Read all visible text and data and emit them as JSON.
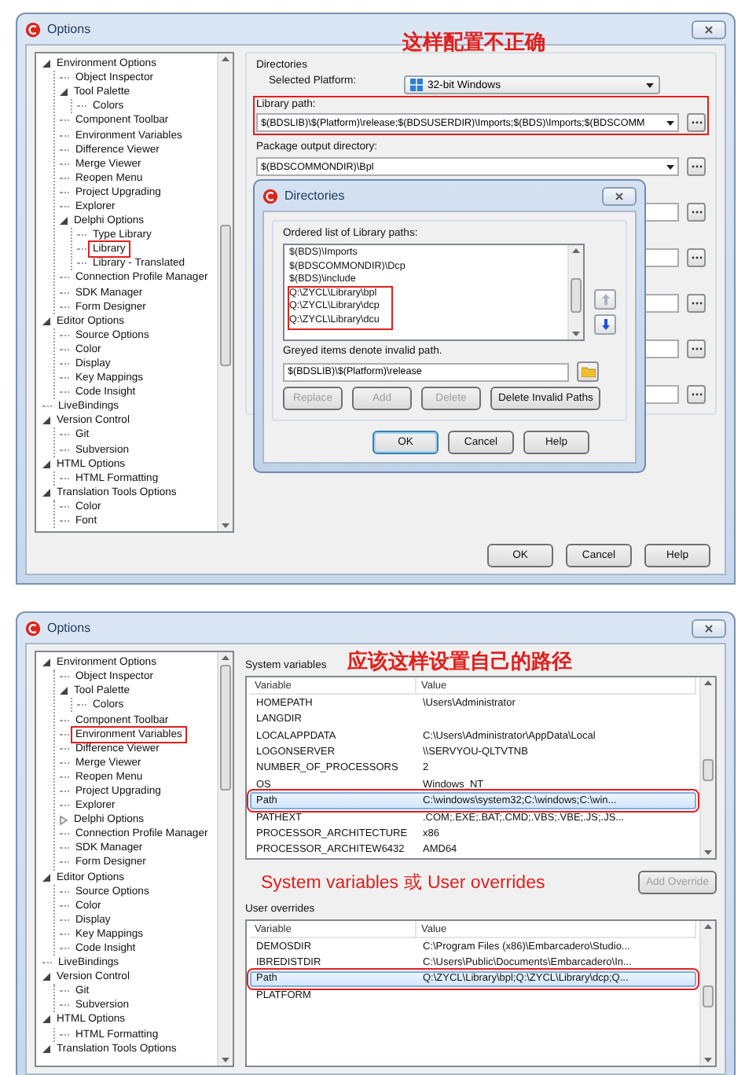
{
  "top_window": {
    "title": "Options",
    "annotation": "这样配置不正确",
    "tree": [
      {
        "label": "Environment Options",
        "highlighted": false,
        "expanded": true,
        "children": [
          {
            "label": "Object Inspector",
            "highlighted": false
          },
          {
            "label": "Tool Palette",
            "highlighted": false,
            "expanded": true,
            "children": [
              {
                "label": "Colors",
                "highlighted": false
              }
            ]
          },
          {
            "label": "Component Toolbar",
            "highlighted": false
          },
          {
            "label": "Environment Variables",
            "highlighted": false
          },
          {
            "label": "Difference Viewer",
            "highlighted": false
          },
          {
            "label": "Merge Viewer",
            "highlighted": false
          },
          {
            "label": "Reopen Menu",
            "highlighted": false
          },
          {
            "label": "Project Upgrading",
            "highlighted": false
          },
          {
            "label": "Explorer",
            "highlighted": false
          },
          {
            "label": "Delphi Options",
            "highlighted": false,
            "expanded": true,
            "children": [
              {
                "label": "Type Library",
                "highlighted": false
              },
              {
                "label": "Library",
                "highlighted": true
              },
              {
                "label": "Library - Translated",
                "highlighted": false
              }
            ]
          },
          {
            "label": "Connection Profile Manager",
            "highlighted": false
          },
          {
            "label": "SDK Manager",
            "highlighted": false
          },
          {
            "label": "Form Designer",
            "highlighted": false
          }
        ]
      },
      {
        "label": "Editor Options",
        "highlighted": false,
        "expanded": true,
        "children": [
          {
            "label": "Source Options",
            "highlighted": false
          },
          {
            "label": "Color",
            "highlighted": false
          },
          {
            "label": "Display",
            "highlighted": false
          },
          {
            "label": "Key Mappings",
            "highlighted": false
          },
          {
            "label": "Code Insight",
            "highlighted": false
          }
        ]
      },
      {
        "label": "LiveBindings",
        "highlighted": false
      },
      {
        "label": "Version Control",
        "highlighted": false,
        "expanded": true,
        "children": [
          {
            "label": "Git",
            "highlighted": false
          },
          {
            "label": "Subversion",
            "highlighted": false
          }
        ]
      },
      {
        "label": "HTML Options",
        "highlighted": false,
        "expanded": true,
        "children": [
          {
            "label": "HTML Formatting",
            "highlighted": false
          }
        ]
      },
      {
        "label": "Translation Tools Options",
        "highlighted": false,
        "expanded": true,
        "children": [
          {
            "label": "Color",
            "highlighted": false
          },
          {
            "label": "Font",
            "highlighted": false
          }
        ]
      }
    ],
    "directories": {
      "heading": "Directories",
      "platform_label": "Selected Platform:",
      "platform": "32-bit Windows",
      "library_path": {
        "label": "Library path:",
        "value": "$(BDSLIB)\\$(Platform)\\release;$(BDSUSERDIR)\\Imports;$(BDS)\\Imports;$(BDSCOMM",
        "highlighted": true
      },
      "package_output": {
        "label": "Package output directory:",
        "value": "$(BDSCOMMONDIR)\\Bpl"
      }
    },
    "dialog": {
      "title": "Directories",
      "list_label": "Ordered list of Library paths:",
      "paths": [
        "$(BDS)\\Imports",
        "$(BDSCOMMONDIR)\\Dcp",
        "$(BDS)\\include"
      ],
      "marked_paths": [
        "Q:\\ZYCL\\Library\\bpl",
        "Q:\\ZYCL\\Library\\dcp",
        "Q:\\ZYCL\\Library\\dcu"
      ],
      "hint": "Greyed items denote invalid path.",
      "entry": "$(BDSLIB)\\$(Platform)\\release",
      "actions": [
        {
          "label": "Replace",
          "disabled": true
        },
        {
          "label": "Add",
          "disabled": true
        },
        {
          "label": "Delete",
          "disabled": true
        },
        {
          "label": "Delete Invalid Paths",
          "disabled": false
        }
      ],
      "buttons": [
        {
          "label": "OK",
          "default": true
        },
        {
          "label": "Cancel",
          "default": false
        },
        {
          "label": "Help",
          "default": false
        }
      ]
    },
    "buttons": [
      "OK",
      "Cancel",
      "Help"
    ]
  },
  "bottom_window": {
    "title": "Options",
    "annotation": "应该这样设置自己的路径",
    "tree": [
      {
        "label": "Environment Options",
        "highlighted": false,
        "expanded": true,
        "children": [
          {
            "label": "Object Inspector",
            "highlighted": false
          },
          {
            "label": "Tool Palette",
            "highlighted": false,
            "expanded": true,
            "children": [
              {
                "label": "Colors",
                "highlighted": false
              }
            ]
          },
          {
            "label": "Component Toolbar",
            "highlighted": false
          },
          {
            "label": "Environment Variables",
            "highlighted": true
          },
          {
            "label": "Difference Viewer",
            "highlighted": false
          },
          {
            "label": "Merge Viewer",
            "highlighted": false
          },
          {
            "label": "Reopen Menu",
            "highlighted": false
          },
          {
            "label": "Project Upgrading",
            "highlighted": false
          },
          {
            "label": "Explorer",
            "highlighted": false
          },
          {
            "label": "Delphi Options",
            "highlighted": false,
            "expanded": false
          },
          {
            "label": "Connection Profile Manager",
            "highlighted": false
          },
          {
            "label": "SDK Manager",
            "highlighted": false
          },
          {
            "label": "Form Designer",
            "highlighted": false
          }
        ]
      },
      {
        "label": "Editor Options",
        "highlighted": false,
        "expanded": true,
        "children": [
          {
            "label": "Source Options",
            "highlighted": false
          },
          {
            "label": "Color",
            "highlighted": false
          },
          {
            "label": "Display",
            "highlighted": false
          },
          {
            "label": "Key Mappings",
            "highlighted": false
          },
          {
            "label": "Code Insight",
            "highlighted": false
          }
        ]
      },
      {
        "label": "LiveBindings",
        "highlighted": false
      },
      {
        "label": "Version Control",
        "highlighted": false,
        "expanded": true,
        "children": [
          {
            "label": "Git",
            "highlighted": false
          },
          {
            "label": "Subversion",
            "highlighted": false
          }
        ]
      },
      {
        "label": "HTML Options",
        "highlighted": false,
        "expanded": true,
        "children": [
          {
            "label": "HTML Formatting",
            "highlighted": false
          }
        ]
      },
      {
        "label": "Translation Tools Options",
        "highlighted": false,
        "expanded": true
      }
    ],
    "system_variables": {
      "label": "System variables",
      "columns": [
        "Variable",
        "Value"
      ],
      "rows": [
        {
          "variable": "HOMEPATH",
          "value": "\\Users\\Administrator",
          "selected": false,
          "highlighted": false
        },
        {
          "variable": "LANGDIR",
          "selected": false,
          "highlighted": false
        },
        {
          "variable": "LOCALAPPDATA",
          "value": "C:\\Users\\Administrator\\AppData\\Local",
          "selected": false,
          "highlighted": false
        },
        {
          "variable": "LOGONSERVER",
          "value": "\\\\SERVYOU-QLTVTNB",
          "selected": false,
          "highlighted": false
        },
        {
          "variable": "NUMBER_OF_PROCESSORS",
          "value": "2",
          "selected": false,
          "highlighted": false
        },
        {
          "variable": "OS",
          "value": "Windows_NT",
          "selected": false,
          "highlighted": false
        },
        {
          "variable": "Path",
          "value": "C:\\windows\\system32;C:\\windows;C:\\win...",
          "selected": true,
          "highlighted": true
        },
        {
          "variable": "PATHEXT",
          "value": ".COM;.EXE;.BAT;.CMD;.VBS;.VBE;.JS;.JS...",
          "selected": false,
          "highlighted": false
        },
        {
          "variable": "PROCESSOR_ARCHITECTURE",
          "value": "x86",
          "selected": false,
          "highlighted": false
        },
        {
          "variable": "PROCESSOR_ARCHITEW6432",
          "value": "AMD64",
          "selected": false,
          "highlighted": false
        }
      ]
    },
    "note": "System variables 或 User overrides",
    "add_override": {
      "label": "Add Override",
      "disabled": true
    },
    "user_overrides": {
      "label": "User overrides",
      "columns": [
        "Variable",
        "Value"
      ],
      "rows": [
        {
          "variable": "DEMOSDIR",
          "value": "C:\\Program Files (x86)\\Embarcadero\\Studio...",
          "selected": false,
          "highlighted": false
        },
        {
          "variable": "IBREDISTDIR",
          "value": "C:\\Users\\Public\\Documents\\Embarcadero\\In...",
          "selected": false,
          "highlighted": false
        },
        {
          "variable": "Path",
          "value": "Q:\\ZYCL\\Library\\bpl;Q:\\ZYCL\\Library\\dcp;Q...",
          "selected": true,
          "highlighted": true
        },
        {
          "variable": "PLATFORM",
          "selected": false,
          "highlighted": false
        }
      ]
    }
  }
}
